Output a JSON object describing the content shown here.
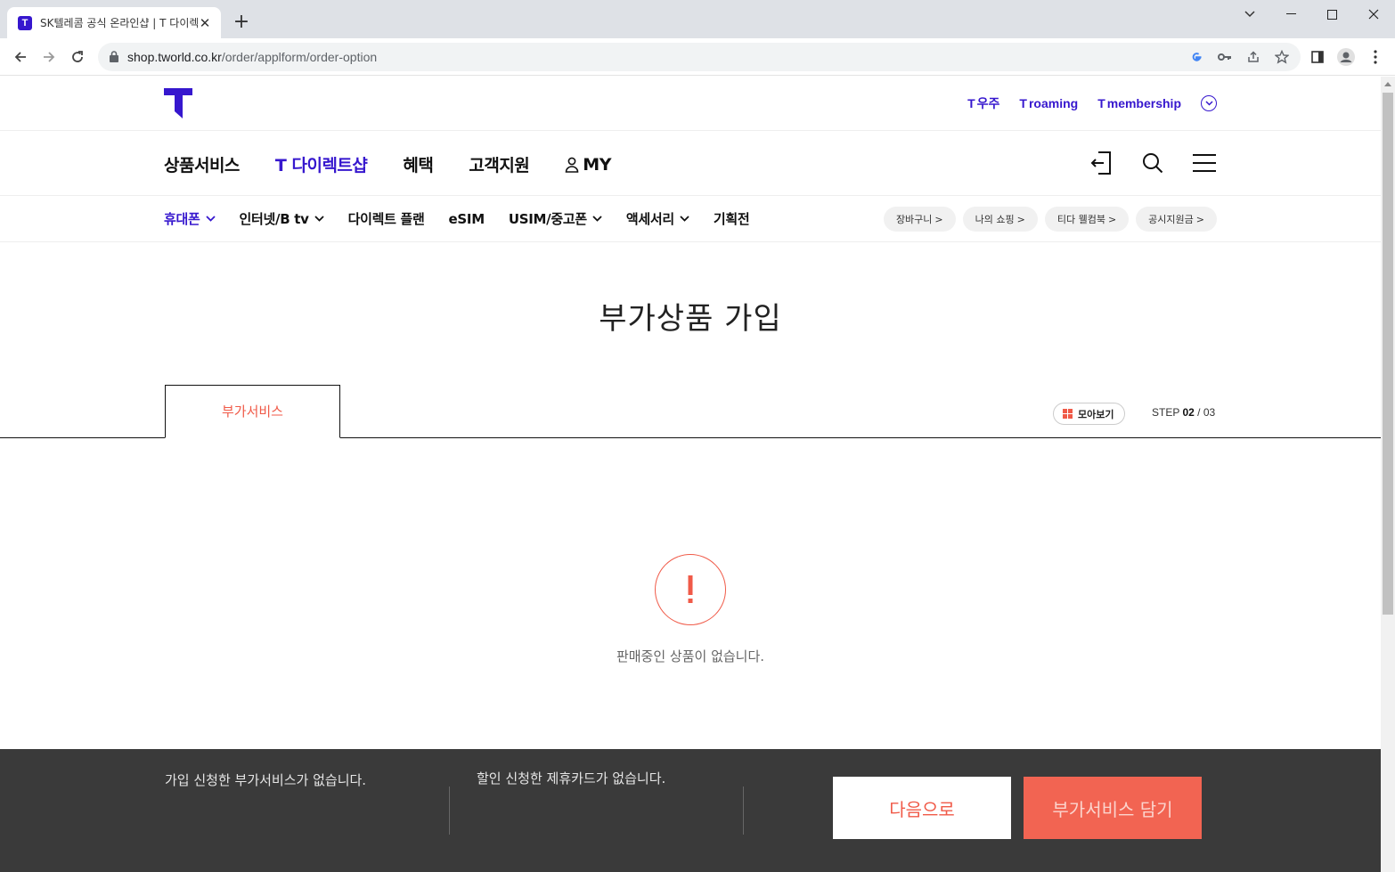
{
  "browser": {
    "tab_title": "SK텔레콤 공식 온라인샵 | T 다이렉트샵",
    "url_host": "shop.tworld.co.kr",
    "url_path": "/order/applform/order-option"
  },
  "util_links": [
    {
      "label": "우주"
    },
    {
      "label": "roaming"
    },
    {
      "label": "membership"
    }
  ],
  "gnb": {
    "items": [
      "상품서비스",
      "T 다이렉트샵",
      "혜택",
      "고객지원",
      "MY"
    ]
  },
  "lnb": {
    "items": [
      "휴대폰",
      "인터넷/B tv",
      "다이렉트 플랜",
      "eSIM",
      "USIM/중고폰",
      "액세서리",
      "기획전"
    ],
    "pills": [
      "장바구니",
      "나의 쇼핑",
      "티다 웰컴북",
      "공시지원금"
    ]
  },
  "page": {
    "title": "부가상품 가입",
    "tab_label": "부가서비스",
    "gather_label": "모아보기",
    "step_prefix": "STEP",
    "step_current": "02",
    "step_total": "/ 03",
    "empty_message": "판매중인 상품이 없습니다."
  },
  "bottom_bar": {
    "service_summary": "가입 신청한 부가서비스가 없습니다.",
    "card_summary": "할인 신청한 제휴카드가 없습니다.",
    "next_label": "다음으로",
    "add_label": "부가서비스 담기"
  },
  "colors": {
    "brand": "#3617ce",
    "accent": "#f05a48",
    "bottom_bar": "#3a3a3a"
  }
}
